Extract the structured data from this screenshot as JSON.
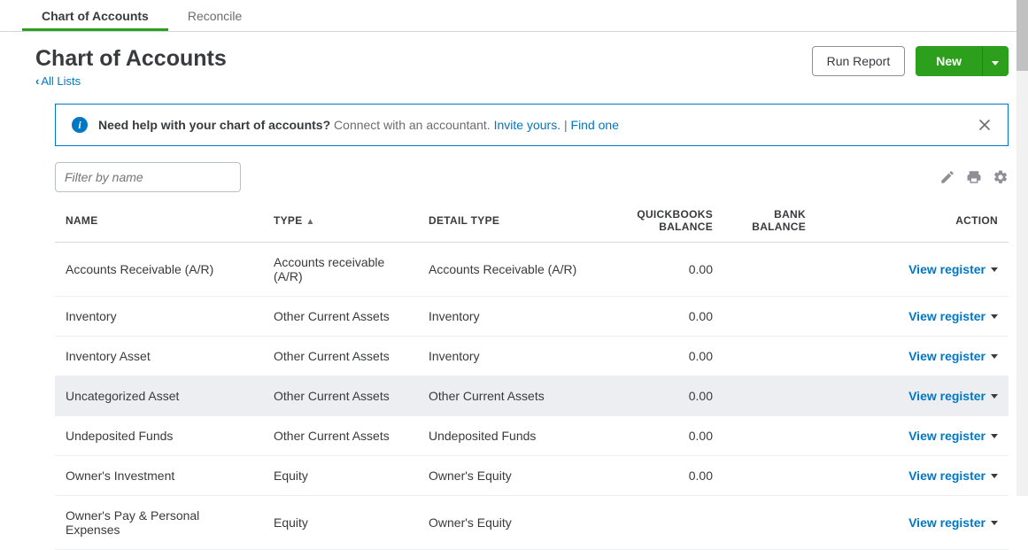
{
  "topnav": {
    "tabs": [
      {
        "label": "Chart of Accounts",
        "active": true
      },
      {
        "label": "Reconcile",
        "active": false
      }
    ]
  },
  "header": {
    "title": "Chart of Accounts",
    "back_label": "All Lists",
    "run_report_label": "Run Report",
    "new_label": "New"
  },
  "banner": {
    "strong": "Need help with your chart of accounts?",
    "muted": "Connect with an accountant.",
    "link1": "Invite yours.",
    "sep": " | ",
    "link2": "Find one"
  },
  "filter": {
    "placeholder": "Filter by name"
  },
  "columns": {
    "name": "NAME",
    "type": "TYPE",
    "detail": "DETAIL TYPE",
    "qb_balance": "QUICKBOOKS BALANCE",
    "bank_balance": "BANK BALANCE",
    "action": "ACTION",
    "sorted": "type"
  },
  "action_label": "View register",
  "rows": [
    {
      "name": "Accounts Receivable (A/R)",
      "type": "Accounts receivable (A/R)",
      "detail": "Accounts Receivable (A/R)",
      "qb": "0.00",
      "bank": "",
      "selected": false
    },
    {
      "name": "Inventory",
      "type": "Other Current Assets",
      "detail": "Inventory",
      "qb": "0.00",
      "bank": "",
      "selected": false
    },
    {
      "name": "Inventory Asset",
      "type": "Other Current Assets",
      "detail": "Inventory",
      "qb": "0.00",
      "bank": "",
      "selected": false
    },
    {
      "name": "Uncategorized Asset",
      "type": "Other Current Assets",
      "detail": "Other Current Assets",
      "qb": "0.00",
      "bank": "",
      "selected": true
    },
    {
      "name": "Undeposited Funds",
      "type": "Other Current Assets",
      "detail": "Undeposited Funds",
      "qb": "0.00",
      "bank": "",
      "selected": false
    },
    {
      "name": "Owner's Investment",
      "type": "Equity",
      "detail": "Owner's Equity",
      "qb": "0.00",
      "bank": "",
      "selected": false
    },
    {
      "name": "Owner's Pay & Personal Expenses",
      "type": "Equity",
      "detail": "Owner's Equity",
      "qb": "",
      "bank": "",
      "selected": false
    }
  ]
}
